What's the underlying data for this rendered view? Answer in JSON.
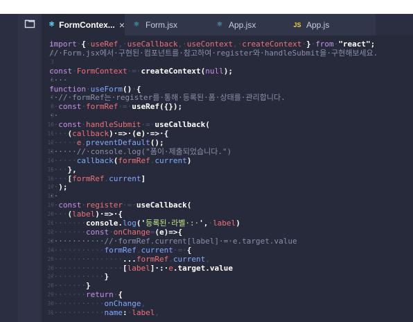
{
  "tabs": [
    {
      "label": "FormContex...",
      "icon": "react-icon",
      "active": true,
      "close": "×"
    },
    {
      "label": "Form.jsx",
      "icon": "react-icon",
      "active": false
    },
    {
      "label": "App.jsx",
      "icon": "react-icon",
      "active": false
    },
    {
      "label": "App.js",
      "icon": "js-icon",
      "active": false,
      "badge": "JS"
    }
  ],
  "icons": {
    "explorer": "files-icon",
    "react": "react-icon",
    "js": "js-icon",
    "close": "close-icon"
  },
  "colors": {
    "background": "#272a3a",
    "keyword": "#c792ea",
    "function": "#82aaff",
    "string": "#c3e88d",
    "variable": "#f07178",
    "comment": "#8a90ab",
    "tab_active_bg": "#272a3a",
    "tab_inactive_bg": "#32364a"
  },
  "editor": {
    "lines": [
      {
        "n": "1",
        "segs": [
          [
            "k",
            "import"
          ],
          [
            "",
            "·"
          ],
          [
            "w",
            "{"
          ],
          [
            "",
            "·"
          ],
          [
            "v",
            "useRef"
          ],
          [
            "",
            ",·"
          ],
          [
            "v",
            "useCallback"
          ],
          [
            "",
            ",·"
          ],
          [
            "v",
            "useContext"
          ],
          [
            "",
            ",·"
          ],
          [
            "v",
            "createContext"
          ],
          [
            "",
            "·"
          ],
          [
            "w",
            "}"
          ],
          [
            "",
            "·"
          ],
          [
            "k",
            "from"
          ],
          [
            "",
            "·"
          ],
          [
            "w",
            "\"react\";"
          ]
        ]
      },
      {
        "n": "2",
        "segs": [
          [
            "c",
            "//·Form.jsx에서·구현된·컴포넌트를·참고하여·register와·handleSubmit을·구현해보세요."
          ]
        ]
      },
      {
        "n": "3",
        "segs": [
          [
            "",
            ""
          ]
        ]
      },
      {
        "n": "4",
        "segs": [
          [
            "k",
            "const"
          ],
          [
            "",
            "·"
          ],
          [
            "v",
            "FormContext"
          ],
          [
            "",
            "·=·"
          ],
          [
            "w",
            "createContext("
          ],
          [
            "k",
            "null"
          ],
          [
            "w",
            ");"
          ]
        ]
      },
      {
        "n": "5",
        "segs": [
          [
            "c",
            "····"
          ]
        ]
      },
      {
        "n": "6",
        "segs": [
          [
            "k",
            "function"
          ],
          [
            "",
            "·"
          ],
          [
            "f",
            "useForm"
          ],
          [
            "w",
            "()"
          ],
          [
            "",
            "·"
          ],
          [
            "w",
            "{"
          ]
        ]
      },
      {
        "n": "7",
        "segs": [
          [
            "c",
            "··//·formRef는·register를·통해·등록된·폼·상태를·관리합니다."
          ]
        ]
      },
      {
        "n": "8",
        "segs": [
          [
            "",
            "··"
          ],
          [
            "k",
            "const"
          ],
          [
            "",
            "·"
          ],
          [
            "v",
            "formRef"
          ],
          [
            "",
            "·=·"
          ],
          [
            "w",
            "useRef({});"
          ]
        ]
      },
      {
        "n": "9",
        "segs": [
          [
            "c",
            "··"
          ]
        ]
      },
      {
        "n": "10",
        "segs": [
          [
            "",
            "··"
          ],
          [
            "k",
            "const"
          ],
          [
            "",
            "·"
          ],
          [
            "v",
            "handleSubmit"
          ],
          [
            "",
            "·=·"
          ],
          [
            "w",
            "useCallback("
          ]
        ]
      },
      {
        "n": "11",
        "segs": [
          [
            "",
            "····"
          ],
          [
            "w",
            "("
          ],
          [
            "v",
            "callback"
          ],
          [
            "w",
            ")·=>·(e)·=>·{"
          ]
        ]
      },
      {
        "n": "12",
        "segs": [
          [
            "",
            "······"
          ],
          [
            "v",
            "e"
          ],
          [
            "",
            ".",
            ""
          ],
          [
            "f",
            "preventDefault"
          ],
          [
            "w",
            "();"
          ]
        ]
      },
      {
        "n": "13",
        "segs": [
          [
            "c",
            "······//·console.log(\"폼이·제출되었습니다.\")"
          ]
        ]
      },
      {
        "n": "14",
        "segs": [
          [
            "",
            "······"
          ],
          [
            "f",
            "callback"
          ],
          [
            "w",
            "("
          ],
          [
            "v",
            "formRef"
          ],
          [
            "",
            "."
          ],
          [
            "f",
            "current"
          ],
          [
            "w",
            ")"
          ]
        ]
      },
      {
        "n": "15",
        "segs": [
          [
            "",
            "····"
          ],
          [
            "w",
            "},"
          ]
        ]
      },
      {
        "n": "16",
        "segs": [
          [
            "",
            "····"
          ],
          [
            "w",
            "["
          ],
          [
            "v",
            "formRef"
          ],
          [
            "",
            "."
          ],
          [
            "f",
            "current"
          ],
          [
            "w",
            "]"
          ]
        ]
      },
      {
        "n": "17",
        "segs": [
          [
            "",
            "··"
          ],
          [
            "w",
            ");"
          ]
        ]
      },
      {
        "n": "18",
        "segs": [
          [
            "c",
            "··"
          ]
        ]
      },
      {
        "n": "19",
        "segs": [
          [
            "",
            "··"
          ],
          [
            "k",
            "const"
          ],
          [
            "",
            "·"
          ],
          [
            "v",
            "register"
          ],
          [
            "",
            "·=·"
          ],
          [
            "w",
            "useCallback("
          ]
        ]
      },
      {
        "n": "20",
        "segs": [
          [
            "",
            "····"
          ],
          [
            "w",
            "("
          ],
          [
            "v",
            "label"
          ],
          [
            "w",
            ")·=>·{"
          ]
        ]
      },
      {
        "n": "21",
        "segs": [
          [
            "",
            "········"
          ],
          [
            "w",
            "console."
          ],
          [
            "f",
            "log"
          ],
          [
            "w",
            "('"
          ],
          [
            "s",
            "등록된·라벨·:·"
          ],
          [
            "w",
            "',"
          ],
          [
            "",
            "·"
          ],
          [
            "v",
            "label"
          ],
          [
            "w",
            ")"
          ]
        ]
      },
      {
        "n": "22",
        "segs": [
          [
            "",
            "········"
          ],
          [
            "k",
            "const"
          ],
          [
            "",
            "·"
          ],
          [
            "v",
            "onChange"
          ],
          [
            "",
            "="
          ],
          [
            "w",
            "(e)=>{"
          ]
        ]
      },
      {
        "n": "23",
        "segs": [
          [
            "c",
            "············//·formRef.current[label]·=·e.target.value"
          ]
        ]
      },
      {
        "n": "24",
        "segs": [
          [
            "",
            "············"
          ],
          [
            "f",
            "formRef"
          ],
          [
            "",
            "."
          ],
          [
            "f",
            "current"
          ],
          [
            "",
            "·=·"
          ],
          [
            "w",
            "{"
          ]
        ]
      },
      {
        "n": "25",
        "segs": [
          [
            "",
            "················"
          ],
          [
            "w",
            "..."
          ],
          [
            "v",
            "formRef"
          ],
          [
            "",
            "."
          ],
          [
            "f",
            "current"
          ],
          [
            "",
            ","
          ]
        ]
      },
      {
        "n": "26",
        "segs": [
          [
            "",
            "················"
          ],
          [
            "w",
            "["
          ],
          [
            "v",
            "label"
          ],
          [
            "w",
            "]·:·"
          ],
          [
            "v",
            "e"
          ],
          [
            "w",
            ".target.value"
          ]
        ]
      },
      {
        "n": "27",
        "segs": [
          [
            "",
            "············"
          ],
          [
            "w",
            "}"
          ]
        ]
      },
      {
        "n": "28",
        "segs": [
          [
            "",
            "········"
          ],
          [
            "w",
            "}"
          ]
        ]
      },
      {
        "n": "29",
        "segs": [
          [
            "",
            "········"
          ],
          [
            "k",
            "return"
          ],
          [
            "",
            "·"
          ],
          [
            "w",
            "{"
          ]
        ]
      },
      {
        "n": "30",
        "segs": [
          [
            "",
            "············"
          ],
          [
            "f",
            "onChange"
          ],
          [
            "",
            ","
          ]
        ]
      },
      {
        "n": "31",
        "segs": [
          [
            "",
            "············"
          ],
          [
            "f",
            "name"
          ],
          [
            "w",
            ":"
          ],
          [
            "",
            "·"
          ],
          [
            "v",
            "label"
          ],
          [
            "",
            ","
          ]
        ]
      }
    ]
  }
}
